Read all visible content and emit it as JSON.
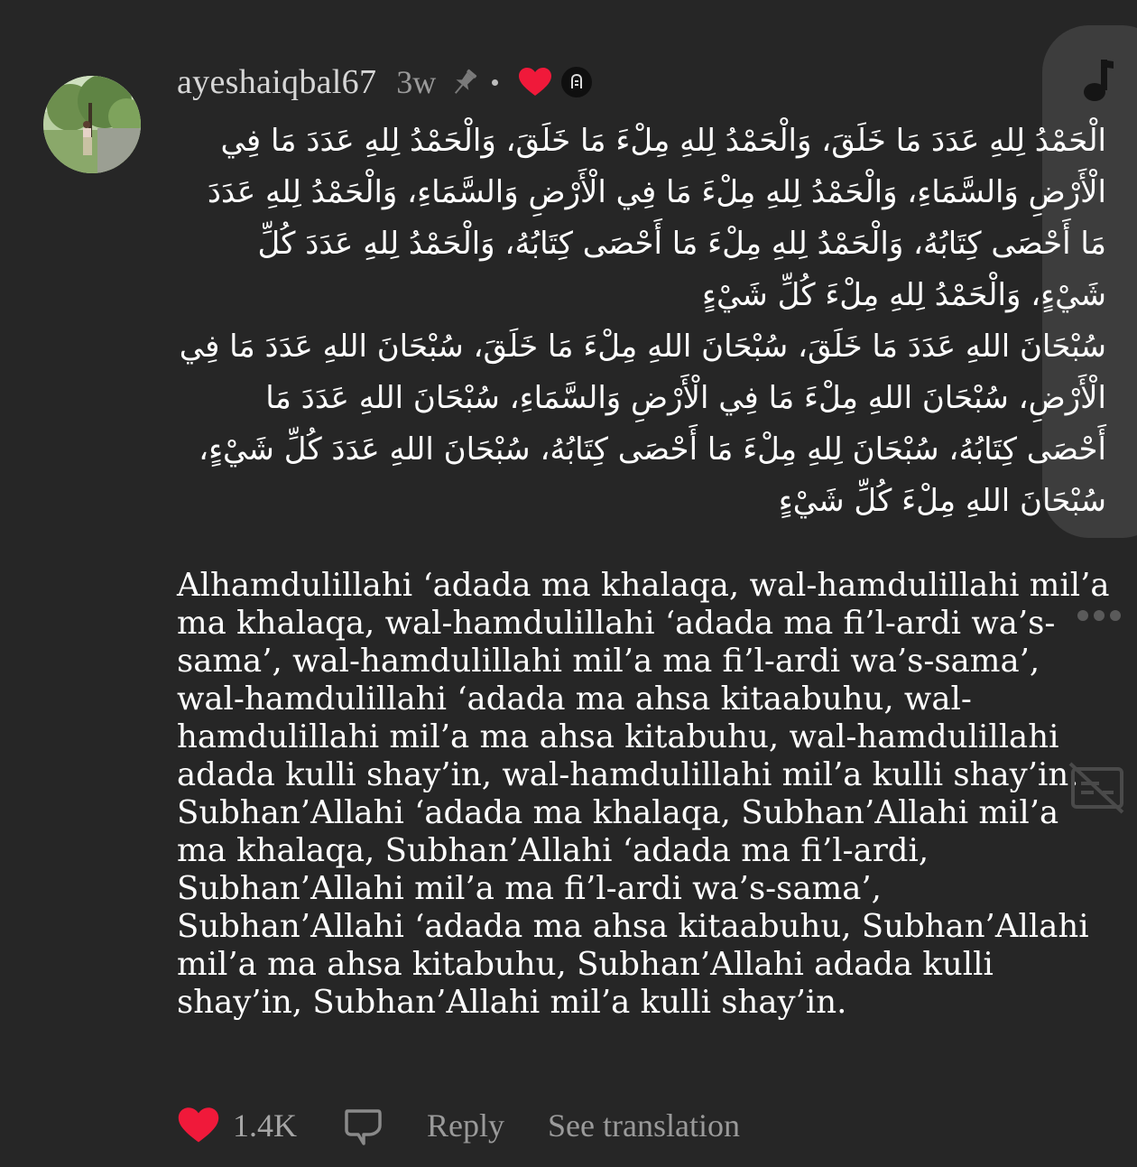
{
  "comment": {
    "username": "ayeshaiqbal67",
    "time_ago": "3w",
    "arabic_lines": [
      "الْحَمْدُ لِلهِ عَدَدَ مَا خَلَقَ، وَالْحَمْدُ لِلهِ مِلْءَ مَا خَلَقَ، وَالْحَمْدُ لِلهِ عَدَدَ مَا فِي الْأَرْضِ وَالسَّمَاءِ، وَالْحَمْدُ لِلهِ مِلْءَ مَا فِي الْأَرْضِ وَالسَّمَاءِ، وَالْحَمْدُ لِلهِ عَدَدَ مَا أَحْصَى كِتَابُهُ، وَالْحَمْدُ لِلهِ مِلْءَ مَا أَحْصَى كِتَابُهُ، وَالْحَمْدُ لِلهِ عَدَدَ كُلِّ شَيْءٍ، وَالْحَمْدُ لِلهِ مِلْءَ كُلِّ شَيْءٍ",
      "سُبْحَانَ اللهِ عَدَدَ مَا خَلَقَ، سُبْحَانَ اللهِ مِلْءَ مَا خَلَقَ، سُبْحَانَ اللهِ عَدَدَ مَا فِي الْأَرْضِ، سُبْحَانَ اللهِ مِلْءَ مَا فِي الْأَرْضِ وَالسَّمَاءِ، سُبْحَانَ اللهِ عَدَدَ مَا أَحْصَى كِتَابُهُ، سُبْحَانَ لِلهِ مِلْءَ مَا أَحْصَى كِتَابُهُ، سُبْحَانَ اللهِ عَدَدَ كُلِّ شَيْءٍ، سُبْحَانَ اللهِ مِلْءَ كُلِّ شَيْءٍ"
    ],
    "latin_lines": [
      "Alhamdulillahi ‘adada ma khalaqa, wal-hamdulillahi mil’a ma khalaqa, wal-hamdulillahi ‘adada ma fi’l-ardi wa’s-sama’, wal-hamdulillahi mil’a ma fi’l-ardi wa’s-sama’, wal-hamdulillahi ‘adada ma ahsa kitaabuhu, wal-hamdulillahi mil’a ma ahsa kitabuhu, wal-hamdulillahi adada kulli shay’in, wal-hamdulillahi mil’a kulli shay’in.",
      "Subhan’Allahi ‘adada ma khalaqa, Subhan’Allahi mil’a ma khalaqa, Subhan’Allahi ‘adada ma fi’l-ardi, Subhan’Allahi mil’a ma fi’l-ardi wa’s-sama’, Subhan’Allahi ‘adada ma ahsa kitaabuhu, Subhan’Allahi mil’a ma ahsa kitabuhu, Subhan’Allahi adada kulli shay’in, Subhan’Allahi mil’a kulli shay’in."
    ]
  },
  "footer": {
    "like_count": "1.4K",
    "reply_label": "Reply",
    "translate_label": "See translation"
  },
  "icons": {
    "avatar": "avatar",
    "pin": "pin-icon",
    "creator_liked": "heart-icon",
    "creator_badge": "creator-badge-icon",
    "like": "heart-icon",
    "reply": "comment-bubble-icon",
    "music": "music-note-icon",
    "more": "more-dots-icon",
    "captions": "captions-off-icon"
  },
  "colors": {
    "background": "#262626",
    "heart": "#f0193a",
    "text": "#ffffff",
    "muted": "#9a9a9a"
  }
}
